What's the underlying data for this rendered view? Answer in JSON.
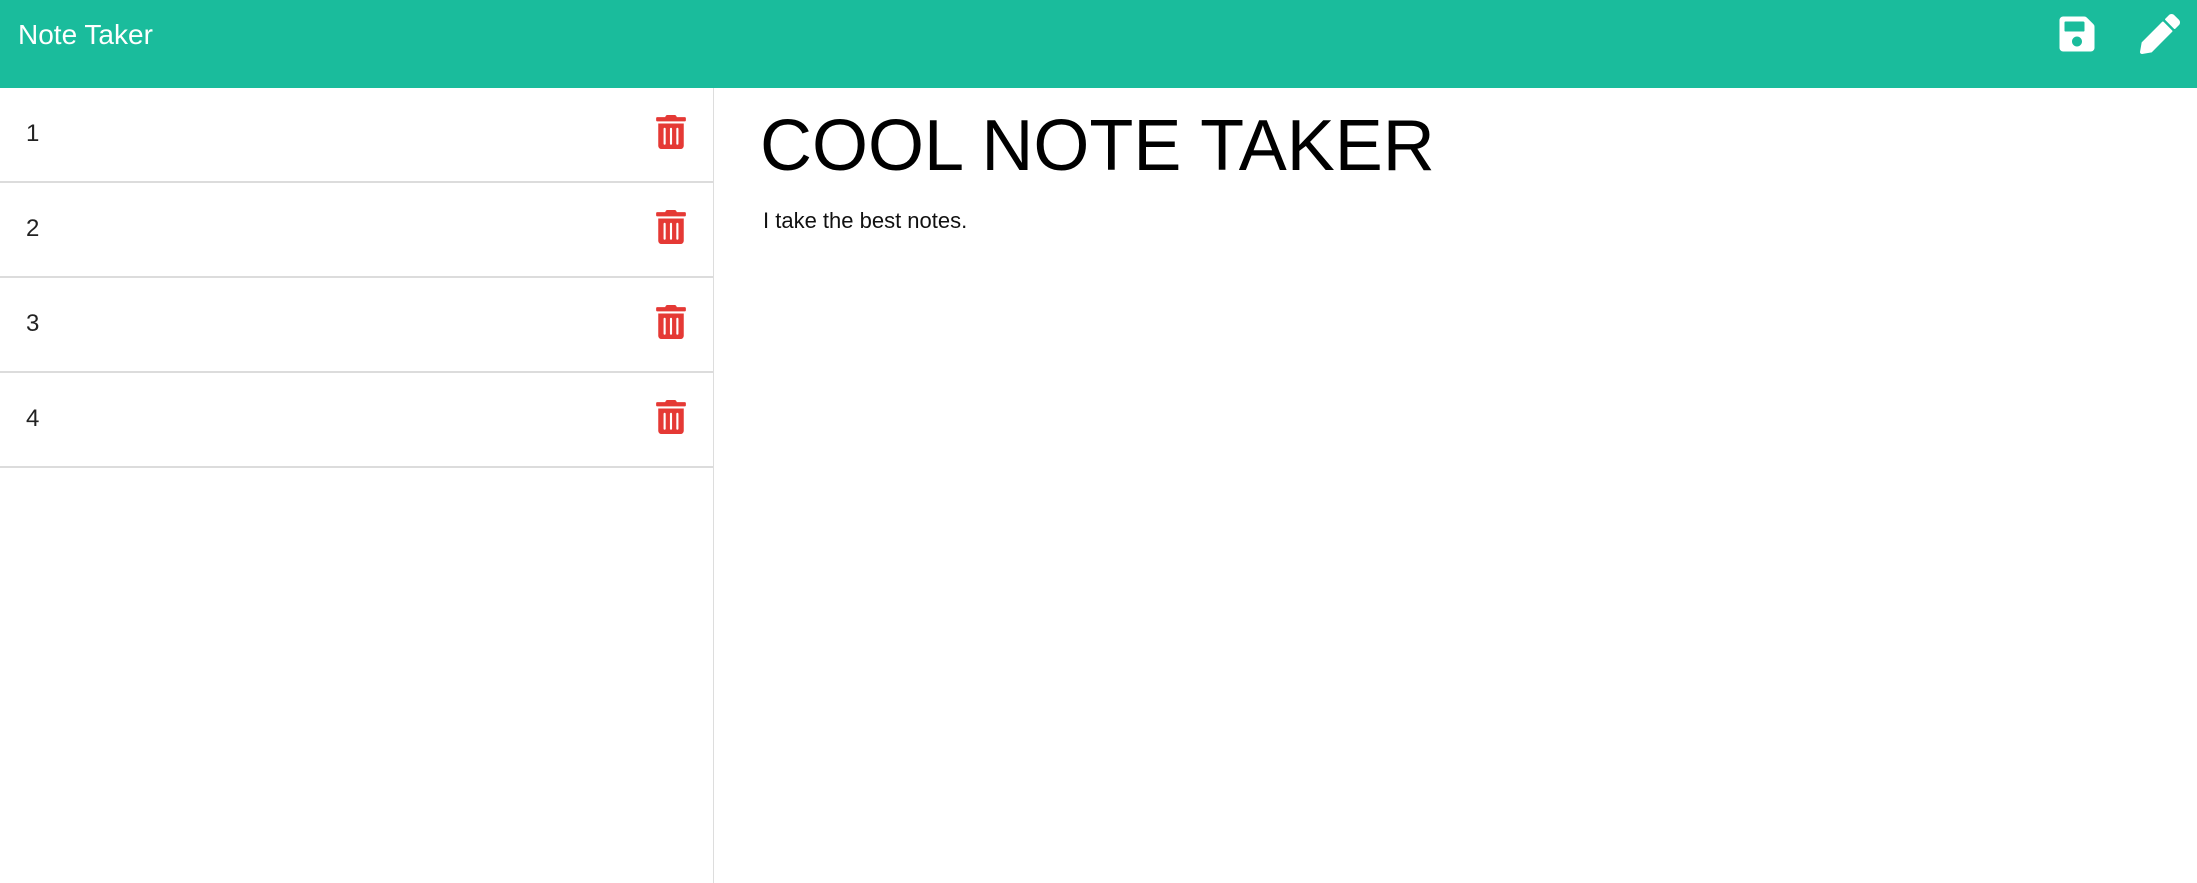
{
  "navbar": {
    "brand": "Note Taker",
    "background_color": "#1abc9c",
    "save_icon": "floppy-disk-icon",
    "new_note_icon": "pencil-icon"
  },
  "sidebar": {
    "notes": [
      {
        "title": "1",
        "delete_icon": "trash-icon"
      },
      {
        "title": "2",
        "delete_icon": "trash-icon"
      },
      {
        "title": "3",
        "delete_icon": "trash-icon"
      },
      {
        "title": "4",
        "delete_icon": "trash-icon"
      }
    ],
    "delete_color": "#e53935"
  },
  "editor": {
    "title_value": "COOL NOTE TAKER",
    "text_value": "I take the best notes."
  }
}
